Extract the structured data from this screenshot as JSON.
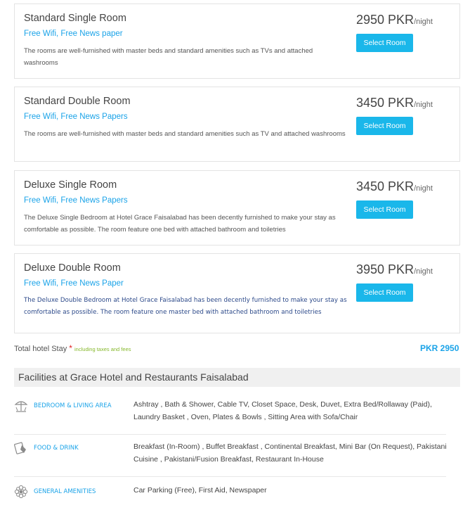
{
  "rooms": [
    {
      "name": "Standard Single Room",
      "amenities": "Free Wifi, Free News paper",
      "description": "The rooms are well-furnished with master beds and standard amenities such as TVs and attached washrooms",
      "price": "2950 PKR",
      "unit": "/night",
      "button": "Select Room"
    },
    {
      "name": "Standard Double Room",
      "amenities": "Free Wifi, Free News Papers",
      "description": "The rooms are well-furnished with master beds and standard amenities such as TV and attached washrooms",
      "price": "3450 PKR",
      "unit": "/night",
      "button": "Select Room"
    },
    {
      "name": "Deluxe Single Room",
      "amenities": "Free Wifi, Free News Papers",
      "description": "The Deluxe Single Bedroom at Hotel Grace Faisalabad has been decently furnished to make your stay as comfortable as possible. The room feature one bed with attached bathroom and toiletries",
      "price": "3450 PKR",
      "unit": "/night",
      "button": "Select Room"
    },
    {
      "name": "Deluxe Double Room",
      "amenities": "Free Wifi, Free News Paper",
      "description": "The Deluxe Double Bedroom at Hotel Grace Faisalabad has been decently furnished to make your stay as comfortable as possible. The room feature one master bed with attached bathroom and toiletries",
      "price": "3950 PKR",
      "unit": "/night",
      "button": "Select Room"
    }
  ],
  "total": {
    "label": "Total hotel Stay",
    "required_mark": "*",
    "note": "including taxes and fees",
    "amount": "PKR 2950"
  },
  "facilities": {
    "header": "Facilities at Grace Hotel and Restaurants Faisalabad",
    "items": [
      {
        "icon": "beach-umbrella-icon",
        "title": "BEDROOM & LIVING AREA",
        "text": "Ashtray , Bath & Shower, Cable TV, Closet Space, Desk, Duvet, Extra Bed/Rollaway (Paid), Laundry Basket , Oven, Plates & Bowls , Sitting Area with Sofa/Chair"
      },
      {
        "icon": "food-drink-icon",
        "title": "FOOD & DRINK",
        "text": "Breakfast (In-Room) , Buffet Breakfast , Continental Breakfast, Mini Bar (On Request), Pakistani Cuisine , Pakistani/Fusion Breakfast, Restaurant In-House"
      },
      {
        "icon": "amenities-flower-icon",
        "title": "GENERAL AMENITIES",
        "text": "Car Parking (Free), First Aid, Newspaper"
      }
    ]
  },
  "colors": {
    "accent": "#1ab7ea",
    "link": "#1aa3e8",
    "note_green": "#86b82c",
    "required_red": "#e02020"
  }
}
